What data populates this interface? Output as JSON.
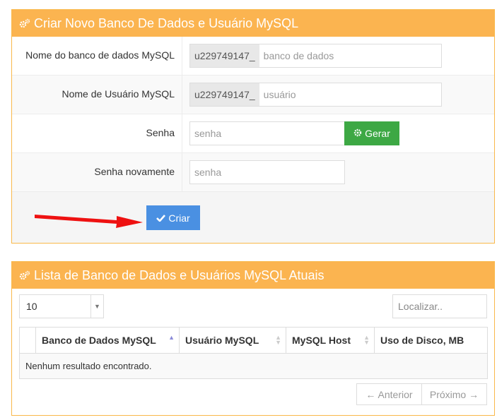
{
  "create_panel": {
    "title": "Criar Novo Banco De Dados e Usuário MySQL",
    "db_name": {
      "label": "Nome do banco de dados MySQL",
      "prefix": "u229749147_",
      "placeholder": "banco de dados"
    },
    "db_user": {
      "label": "Nome de Usuário MySQL",
      "prefix": "u229749147_",
      "placeholder": "usuário"
    },
    "password": {
      "label": "Senha",
      "placeholder": "senha",
      "generate_label": "Gerar"
    },
    "password_again": {
      "label": "Senha novamente",
      "placeholder": "senha"
    },
    "create_label": "Criar"
  },
  "list_panel": {
    "title": "Lista de Banco de Dados e Usuários MySQL Atuais",
    "page_length": "10",
    "search_placeholder": "Localizar..",
    "columns": [
      "Banco de Dados MySQL",
      "Usuário MySQL",
      "MySQL Host",
      "Uso de Disco, MB"
    ],
    "empty_message": "Nenhum resultado encontrado.",
    "prev_label": "← Anterior",
    "next_label": "Próximo →"
  },
  "colors": {
    "panel_header": "#fbb450",
    "generate_button": "#3da844",
    "create_button": "#4a90e2",
    "arrow": "#ee1111"
  }
}
